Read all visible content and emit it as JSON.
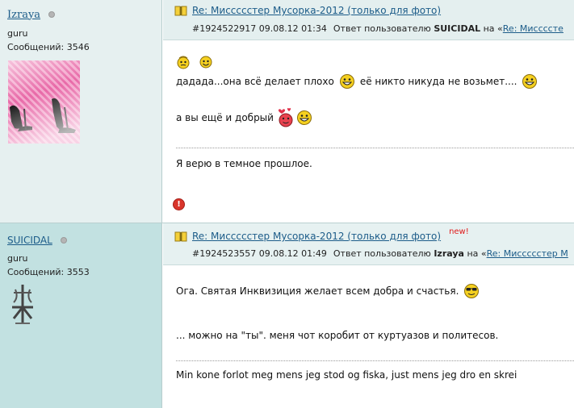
{
  "posts": [
    {
      "author": {
        "name": "Izraya",
        "rank": "guru",
        "messages_label": "Сообщений: 3546"
      },
      "title": "Re: Миссссстер Мусорка-2012 (только для фото)",
      "meta": {
        "id_date": "#1924522917 09.08.12 01:34",
        "reply_prefix": "Ответ пользователю",
        "reply_user": "SUICIDAL",
        "on": "на «",
        "link": "Re: Миссссте"
      },
      "lines": [
        "дадада...она всё делает плохо",
        "её никто никуда не возьмет....",
        "а вы ещё и добрый",
        "Я верю в темное прошлое."
      ]
    },
    {
      "author": {
        "name": "SUICIDAL",
        "rank": "guru",
        "messages_label": "Сообщений: 3553"
      },
      "title": "Re: Миссссстер Мусорка-2012 (только для фото)",
      "new_label": "new!",
      "meta": {
        "id_date": "#1924523557 09.08.12 01:49",
        "reply_prefix": "Ответ пользователю",
        "reply_user": "Izraya",
        "on": "на «",
        "link": "Re: Миссссстер М"
      },
      "lines": [
        "Ога. Святая Инквизиция желает всем добра и счастья.",
        "... можно на \"ты\". меня чот коробит от куртуазов и политесов.",
        "Min kone forlot meg mens jeg stod og fiska, just mens jeg dro en skrei"
      ]
    }
  ],
  "icons": {
    "status": "status-offline-icon",
    "topic": "book-icon",
    "warn": "report-icon"
  },
  "colors": {
    "link": "#1c5c89",
    "new": "#e01b1b",
    "side1": "#e6f0f0",
    "side2": "#c2e1e1"
  }
}
